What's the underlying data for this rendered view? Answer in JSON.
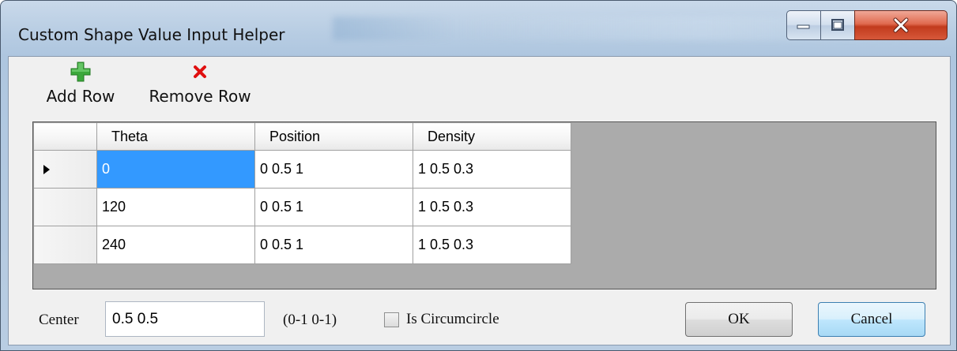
{
  "window": {
    "title": "Custom Shape Value Input Helper"
  },
  "toolbar": {
    "add_row_label": "Add Row",
    "remove_row_label": "Remove Row",
    "add_icon": "plus-icon",
    "remove_icon": "x-icon",
    "add_icon_color": "#3ca83c",
    "remove_icon_color": "#e01010"
  },
  "grid": {
    "columns": [
      "Theta",
      "Position",
      "Density"
    ],
    "rows": [
      {
        "theta": "0",
        "position": "0 0.5 1",
        "density": "1 0.5 0.3",
        "current": true
      },
      {
        "theta": "120",
        "position": "0 0.5 1",
        "density": "1 0.5 0.3",
        "current": false
      },
      {
        "theta": "240",
        "position": "0 0.5 1",
        "density": "1 0.5 0.3",
        "current": false
      }
    ],
    "selection_color": "#3399ff"
  },
  "bottom": {
    "center_label": "Center",
    "center_value": "0.5 0.5",
    "range_hint": "(0-1  0-1)",
    "circumcircle_label": "Is Circumcircle",
    "circumcircle_checked": false,
    "ok_label": "OK",
    "cancel_label": "Cancel"
  }
}
